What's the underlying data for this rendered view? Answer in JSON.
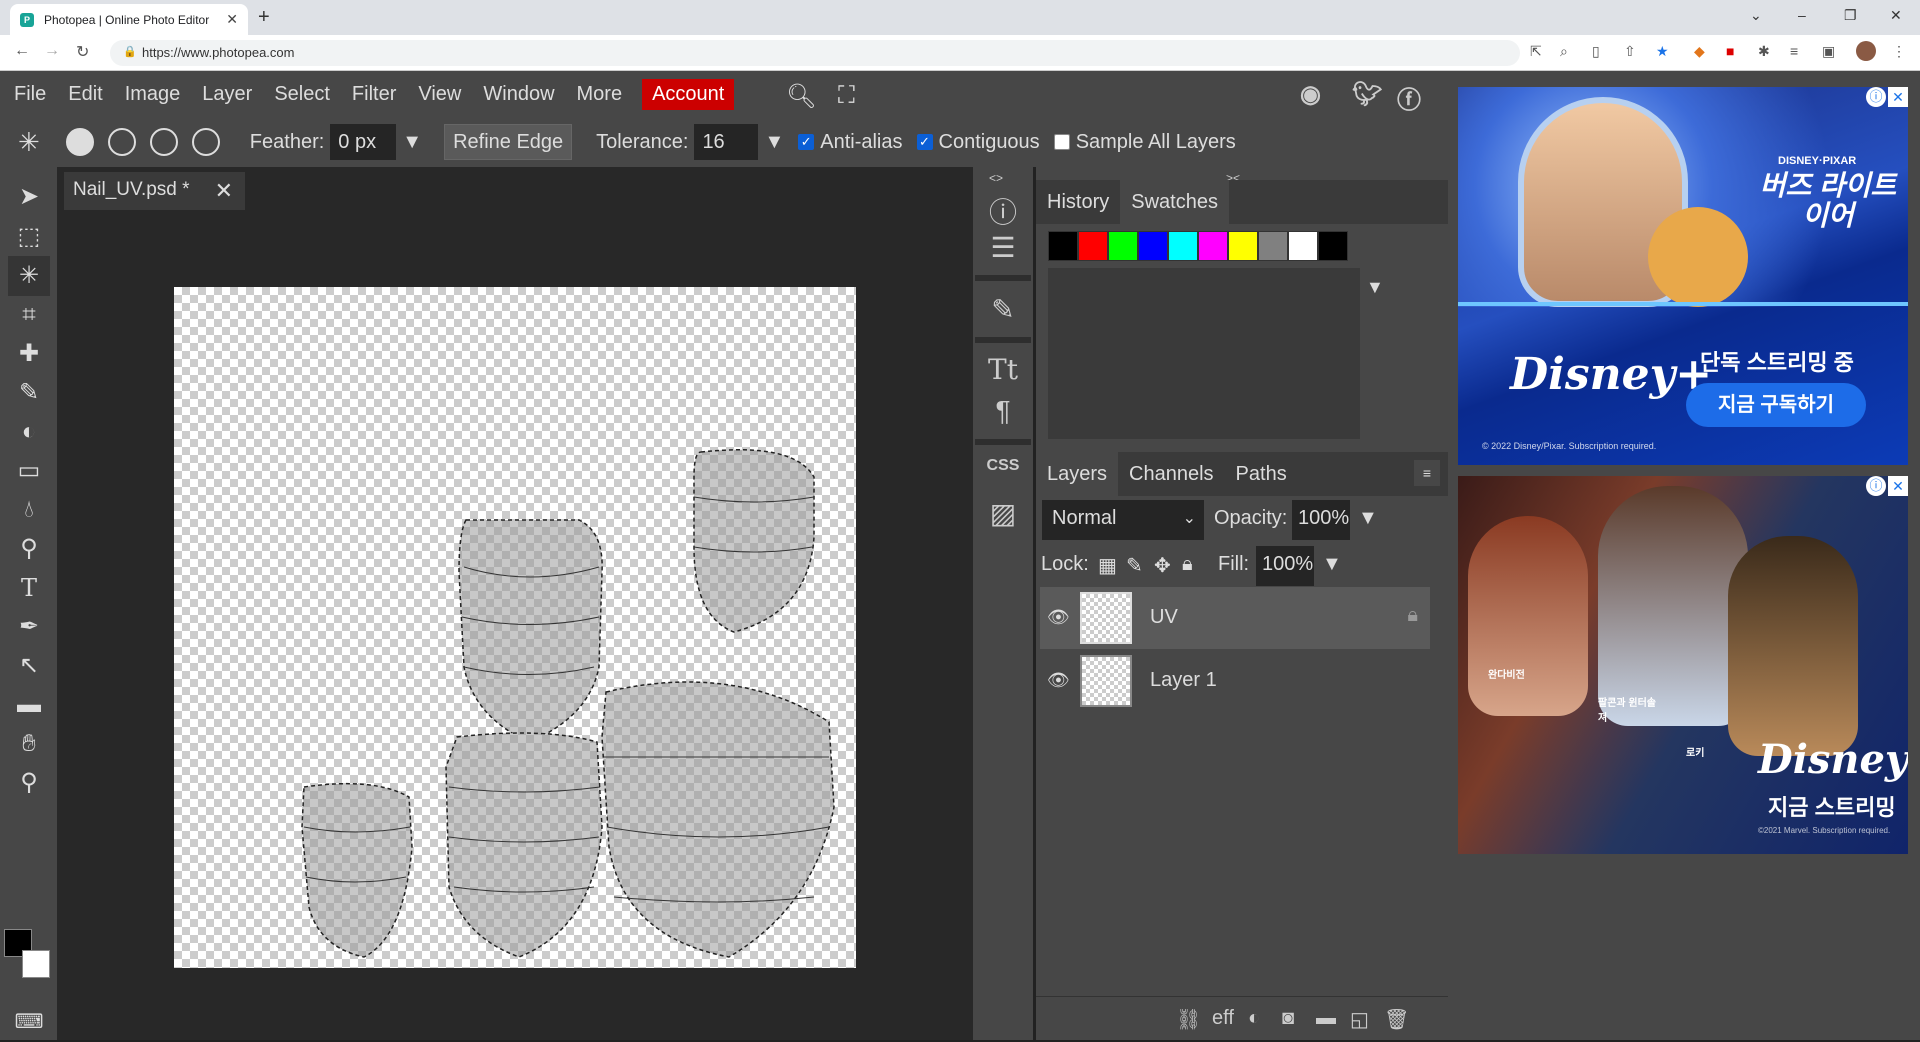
{
  "browser": {
    "tab_title": "Photopea | Online Photo Editor",
    "tab_close": "✕",
    "new_tab": "+",
    "url": "https://www.photopea.com",
    "window_controls": [
      "⌄",
      "–",
      "❐",
      "✕"
    ]
  },
  "menu": {
    "items": [
      "File",
      "Edit",
      "Image",
      "Layer",
      "Select",
      "Filter",
      "View",
      "Window",
      "More"
    ],
    "account": "Account"
  },
  "options": {
    "feather_label": "Feather:",
    "feather_value": "0 px",
    "refine_edge": "Refine Edge",
    "tolerance_label": "Tolerance:",
    "tolerance_value": "16",
    "anti_alias": "Anti-alias",
    "anti_alias_checked": true,
    "contiguous": "Contiguous",
    "contiguous_checked": true,
    "sample_all_layers": "Sample All Layers",
    "sample_all_checked": false
  },
  "document": {
    "tab_title": "Nail_UV.psd *",
    "close": "✕"
  },
  "panels": {
    "collapse_left": "<>",
    "collapse_right": "><",
    "top_tabs": [
      "History",
      "Swatches"
    ],
    "swatch_colors": [
      "#000000",
      "#ff0000",
      "#00ff00",
      "#0000ff",
      "#00ffff",
      "#ff00ff",
      "#ffff00",
      "#808080",
      "#ffffff",
      "#000000"
    ],
    "layer_tabs": [
      "Layers",
      "Channels",
      "Paths"
    ],
    "blend_mode": "Normal",
    "opacity_label": "Opacity:",
    "opacity_value": "100%",
    "lock_label": "Lock:",
    "fill_label": "Fill:",
    "fill_value": "100%",
    "layers": [
      {
        "name": "UV",
        "selected": true,
        "locked": true
      },
      {
        "name": "Layer 1",
        "selected": false,
        "locked": false
      }
    ],
    "bottom_icons": [
      "link-icon",
      "effects-icon",
      "adjustment-icon",
      "mask-icon",
      "folder-icon",
      "new-layer-icon",
      "trash-icon"
    ],
    "effects_label": "eff"
  },
  "ads": {
    "ad1": {
      "logo": "Disney+",
      "brand": "DISNEY·PIXAR",
      "title": "버즈 라이트이어",
      "headline": "단독 스트리밍 중",
      "button": "지금 구독하기",
      "fineprint": "© 2022 Disney/Pixar. Subscription required."
    },
    "ad2": {
      "logo": "Disney+",
      "headline": "지금 스트리밍",
      "caption1": "완다비전",
      "caption2": "팔콘과 윈터솔져",
      "caption3": "로키",
      "fineprint": "©2021 Marvel. Subscription required."
    }
  }
}
